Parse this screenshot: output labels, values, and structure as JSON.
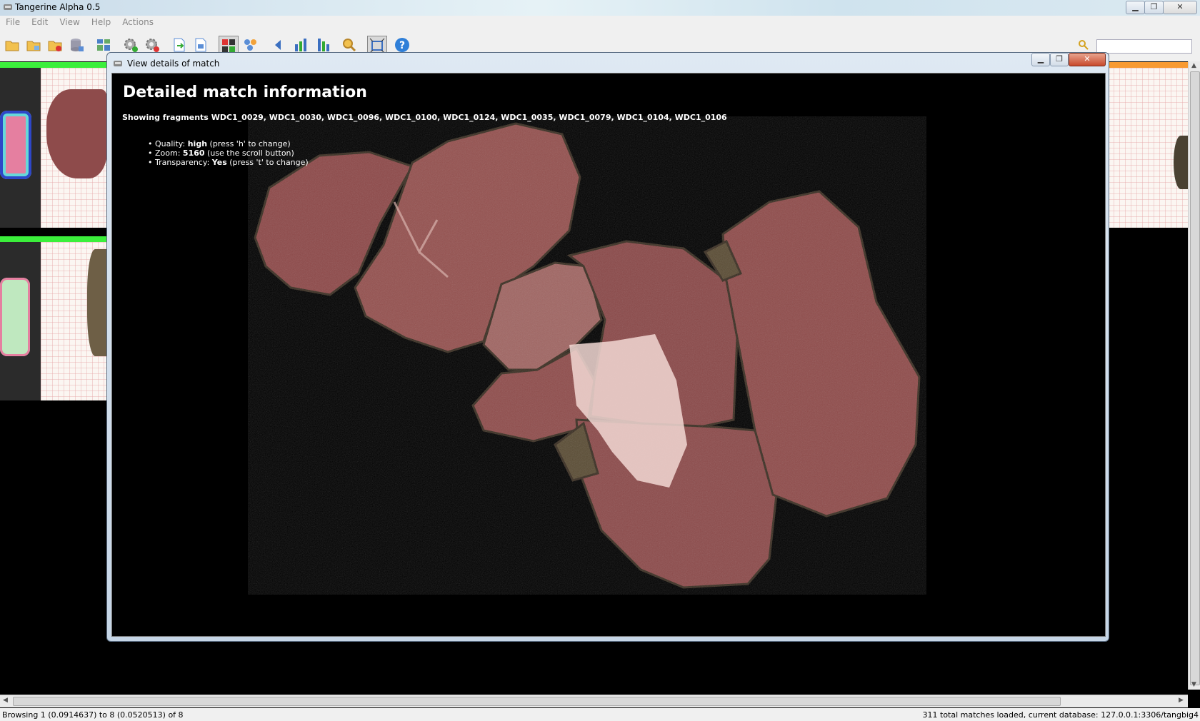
{
  "window": {
    "title": "Tangerine Alpha 0.5",
    "buttons": {
      "minimize": "▁",
      "maximize": "❐",
      "close": "✕"
    }
  },
  "menu": [
    "File",
    "Edit",
    "View",
    "Help",
    "Actions"
  ],
  "toolbar": {
    "icons": [
      "open-folder-icon",
      "open-folder-icon",
      "folder-delete-icon",
      "database-icon",
      "layout-icon",
      "settings-add-icon",
      "settings-remove-icon",
      "export-icon",
      "export-page-icon",
      "color-mode-icon",
      "cluster-icon",
      "back-arrow-icon",
      "sort-ascending-icon",
      "sort-descending-icon",
      "zoom-search-icon",
      "fit-view-icon",
      "help-icon"
    ]
  },
  "dialog": {
    "title": "View details of match",
    "heading": "Detailed match information",
    "showing_prefix": "Showing fragments ",
    "fragments": "WDC1_0029, WDC1_0030, WDC1_0096, WDC1_0100, WDC1_0124, WDC1_0035, WDC1_0079, WDC1_0104, WDC1_0106",
    "info": {
      "quality_label": "Quality: ",
      "quality_value": "high",
      "quality_hint": " (press 'h' to change)",
      "zoom_label": "Zoom: ",
      "zoom_value": "5160",
      "zoom_hint": " (use the scroll button)",
      "transparency_label": "Transparency: ",
      "transparency_value": "Yes",
      "transparency_hint": " (press 't' to change)"
    }
  },
  "statusbar": {
    "left": "Browsing 1 (0.0914637) to 8 (0.0520513) of 8",
    "right": "311 total matches loaded, current database: 127.0.0.1:3306/tangbig4"
  },
  "colors": {
    "band_green": "#3bef3b",
    "band_orange": "#f89a32",
    "fragment_fill": "#8e4b4b",
    "fragment_edge": "#5a4a32"
  }
}
